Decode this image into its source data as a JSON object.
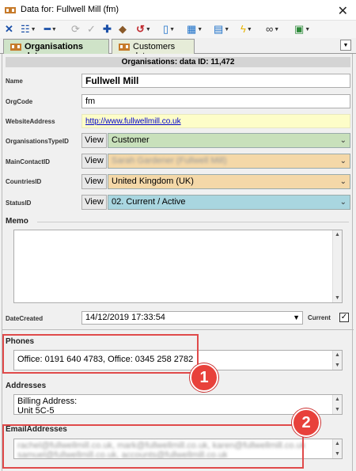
{
  "window": {
    "title": "Data for: Fullwell Mill (fm)",
    "close_glyph": "✕"
  },
  "toolbar": {
    "icons": [
      "close-x-icon",
      "tree-icon",
      "minus-icon",
      "refresh-icon",
      "check-icon",
      "plus-icon",
      "eraser-icon",
      "undo-icon",
      "document-icon",
      "columns-icon",
      "form-layout-icon",
      "lightning-icon",
      "link-icon",
      "image-icon"
    ]
  },
  "tabs": [
    {
      "label": "Organisations data",
      "active": true
    },
    {
      "label": "Customers data",
      "active": false
    }
  ],
  "header": {
    "data_id": "Organisations: data ID: 11,472"
  },
  "fields": {
    "name": {
      "label": "Name",
      "value": "Fullwell Mill"
    },
    "orgcode": {
      "label": "OrgCode",
      "value": "fm"
    },
    "website": {
      "label": "WebsiteAddress",
      "value": "http://www.fullwellmill.co.uk"
    },
    "org_type": {
      "label": "OrganisationsTypeID",
      "view": "View",
      "value": "Customer"
    },
    "main_contact": {
      "label": "MainContactID",
      "view": "View",
      "value": "Sarah Gardener (Fullwell Mill)"
    },
    "countries": {
      "label": "CountriesID",
      "view": "View",
      "value": "United Kingdom (UK)"
    },
    "status": {
      "label": "StatusID",
      "view": "View",
      "value": "02. Current / Active"
    }
  },
  "memo": {
    "label": "Memo",
    "value": ""
  },
  "date_created": {
    "label": "DateCreated",
    "value": "14/12/2019 17:33:54"
  },
  "current": {
    "label": "Current",
    "checked": true,
    "mark": "✓"
  },
  "phones": {
    "label": "Phones",
    "value": "Office: 0191 640 4783, Office: 0345 258 2782"
  },
  "addresses": {
    "label": "Addresses",
    "line1": "Billing Address:",
    "line2": "Unit 5C-5"
  },
  "emails": {
    "label": "EmailAddresses",
    "line1": "rachel@fullwellmill.co.uk, mark@fullwellmill.co.uk, karen@fullwellmill.co.uk",
    "line2": "samuel@fullwellmill.co.uk, accounts@fullwellmill.co.uk"
  },
  "annotations": [
    {
      "number": "1"
    },
    {
      "number": "2"
    }
  ],
  "colors": {
    "tab_active": "#cfe3c8",
    "combo_green": "#c8e0bb",
    "combo_orange": "#f4d8a8",
    "combo_blue": "#a9d6e0",
    "highlight_red": "#e04a4a",
    "badge_red": "#e8413b"
  }
}
